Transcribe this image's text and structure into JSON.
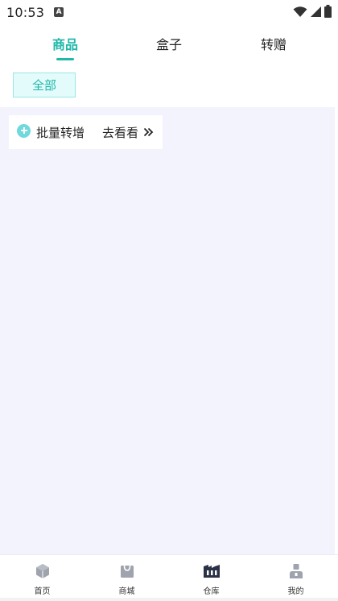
{
  "status_bar": {
    "time": "10:53",
    "notification_icon": "a-icon",
    "right_icons": [
      "wifi-icon",
      "signal-icon",
      "battery-icon"
    ]
  },
  "tabs": [
    {
      "label": "商品",
      "active": true
    },
    {
      "label": "盒子",
      "active": false
    },
    {
      "label": "转赠",
      "active": false
    }
  ],
  "filter": {
    "label": "全部"
  },
  "batch_card": {
    "icon": "plus-circle-icon",
    "label": "批量转增",
    "link_label": "去看看",
    "link_icon": "double-chevron-right-icon"
  },
  "bottom_nav": [
    {
      "label": "首页",
      "icon": "home-cube-icon",
      "active": false
    },
    {
      "label": "商城",
      "icon": "shopping-bag-icon",
      "active": false
    },
    {
      "label": "仓库",
      "icon": "warehouse-icon",
      "active": true
    },
    {
      "label": "我的",
      "icon": "profile-icon",
      "active": false
    }
  ],
  "colors": {
    "accent": "#1fb8a9",
    "background": "#f2f3fc",
    "chip_bg": "#e3fbfb",
    "icon_inactive": "#9ea3ad",
    "icon_active": "#2b3146"
  }
}
